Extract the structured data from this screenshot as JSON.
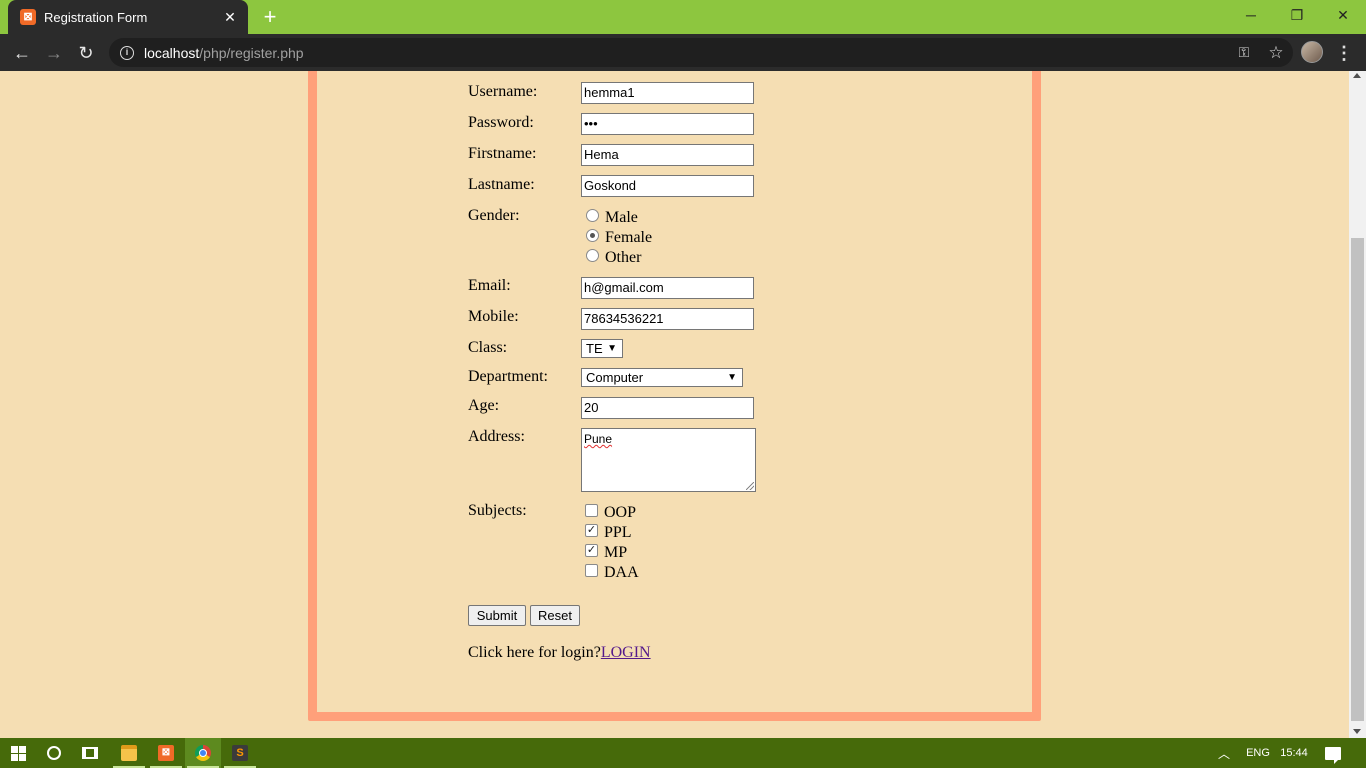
{
  "browser": {
    "tab_title": "Registration Form",
    "tab_favicon_glyph": "⊠",
    "tab_close_glyph": "✕",
    "new_tab_glyph": "+",
    "window_minimize_glyph": "─",
    "window_restore_glyph": "❐",
    "window_close_glyph": "✕",
    "back_glyph": "←",
    "forward_glyph": "→",
    "reload_glyph": "↻",
    "info_glyph": "i",
    "url_host": "localhost",
    "url_path": "/php/register.php",
    "key_glyph": "⚿",
    "star_glyph": "☆",
    "menu_glyph": "⋮",
    "colors": {
      "frame": "#8dc63f",
      "toolbar": "#2b2b2b"
    }
  },
  "form": {
    "username_label": "Username:",
    "username_value": "hemma1",
    "password_label": "Password:",
    "password_value": "•••",
    "firstname_label": "Firstname:",
    "firstname_value": "Hema",
    "lastname_label": "Lastname:",
    "lastname_value": "Goskond",
    "gender_label": "Gender:",
    "gender_options": [
      {
        "label": "Male",
        "checked": false
      },
      {
        "label": "Female",
        "checked": true
      },
      {
        "label": "Other",
        "checked": false
      }
    ],
    "email_label": "Email:",
    "email_value": "h@gmail.com",
    "mobile_label": "Mobile:",
    "mobile_value": "78634536221",
    "class_label": "Class:",
    "class_value": "TE",
    "department_label": "Department:",
    "department_value": "Computer",
    "age_label": "Age:",
    "age_value": "20",
    "address_label": "Address:",
    "address_value": "Pune",
    "subjects_label": "Subjects:",
    "subjects": [
      {
        "label": "OOP",
        "checked": false
      },
      {
        "label": "PPL",
        "checked": true
      },
      {
        "label": "MP",
        "checked": true
      },
      {
        "label": "DAA",
        "checked": false
      }
    ],
    "check_glyph": "✓",
    "dropdown_glyph": "▼",
    "submit_label": "Submit",
    "reset_label": "Reset",
    "login_prompt": "Click here for login?",
    "login_link": "LOGIN",
    "colors": {
      "background": "#f5deb3",
      "border": "#ffa07a",
      "link": "#551a8b"
    }
  },
  "taskbar": {
    "language": "ENG",
    "time": "15:44",
    "tray_chevron_glyph": "︿",
    "xampp_glyph": "⊠",
    "sublime_glyph": "S",
    "color": "#466a0a"
  }
}
